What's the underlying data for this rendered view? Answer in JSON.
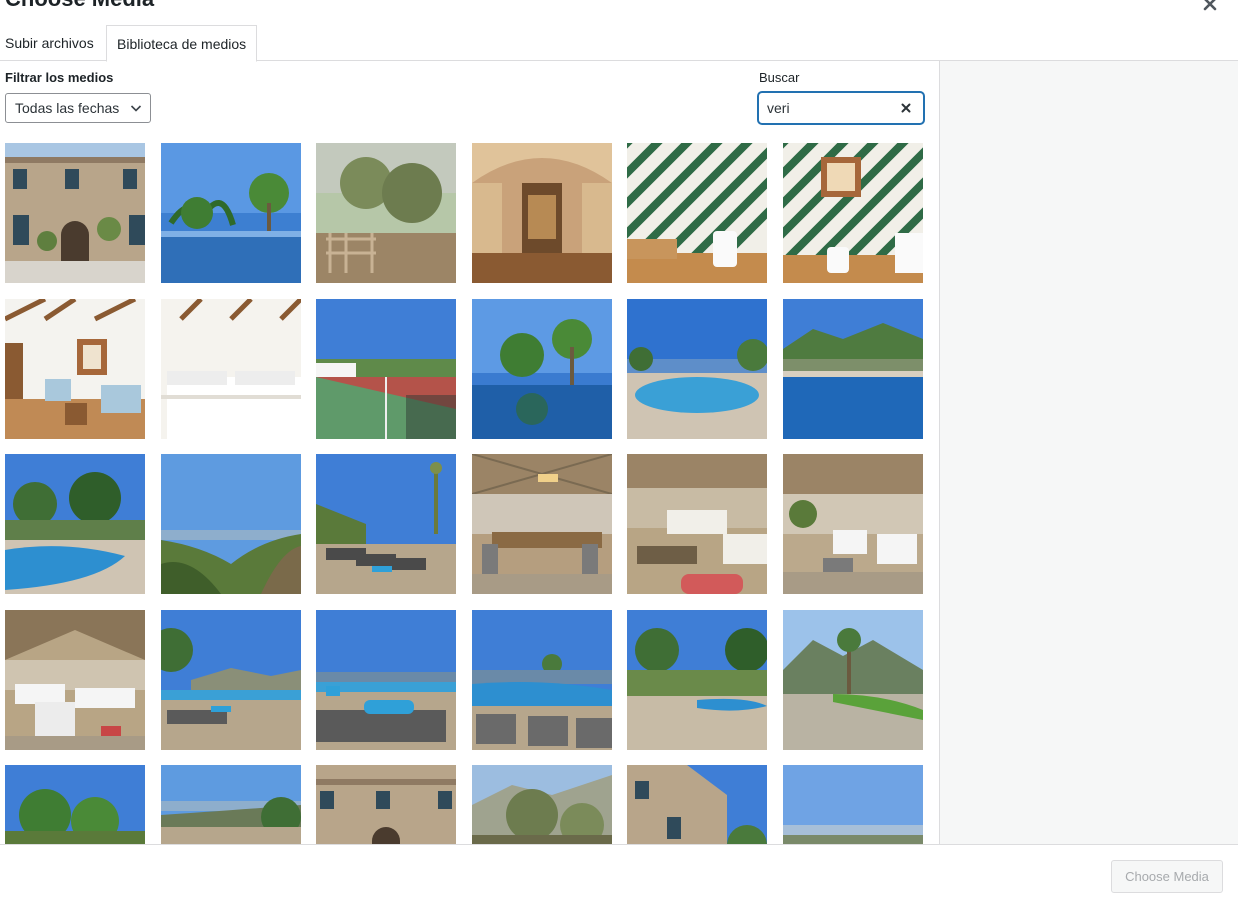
{
  "modal": {
    "title": "Choose Media"
  },
  "tabs": [
    {
      "label": "Subir archivos",
      "active": false
    },
    {
      "label": "Biblioteca de medios",
      "active": true
    }
  ],
  "filter": {
    "label": "Filtrar los medios",
    "selected": "Todas las fechas"
  },
  "search": {
    "label": "Buscar",
    "value": "veri"
  },
  "colors": {
    "accent": "#2271b1",
    "border": "#dcdcde",
    "sidebar_bg": "#f6f7f7"
  },
  "media_items": [
    "stone-house-facade",
    "infinity-pool-palms",
    "olive-trees-gate",
    "wine-cellar-arch",
    "green-striped-bathroom",
    "striped-bathroom-window",
    "living-room-chairs",
    "twin-bedroom",
    "tennis-court",
    "pool-palms-reflection",
    "infinity-pool-sea",
    "pool-mountain-view",
    "pool-garden",
    "valley-sea-view",
    "sun-loungers-terrace",
    "pergola-dining",
    "pergola-lounge",
    "pergola-seating",
    "pergola-sofas",
    "loungers-mountains",
    "loungers-blue-cushions",
    "pool-terrace-chairs",
    "pool-terrace-trees",
    "lawn-palm-mountains",
    "garden-trees",
    "terrace-sea-view",
    "house-facade-door",
    "olive-grove",
    "house-side-view",
    "sky-horizon"
  ],
  "footer": {
    "choose_button": "Choose Media"
  },
  "icons": {
    "close": "close-icon",
    "chevron": "chevron-down-icon",
    "clear": "clear-search-icon"
  }
}
